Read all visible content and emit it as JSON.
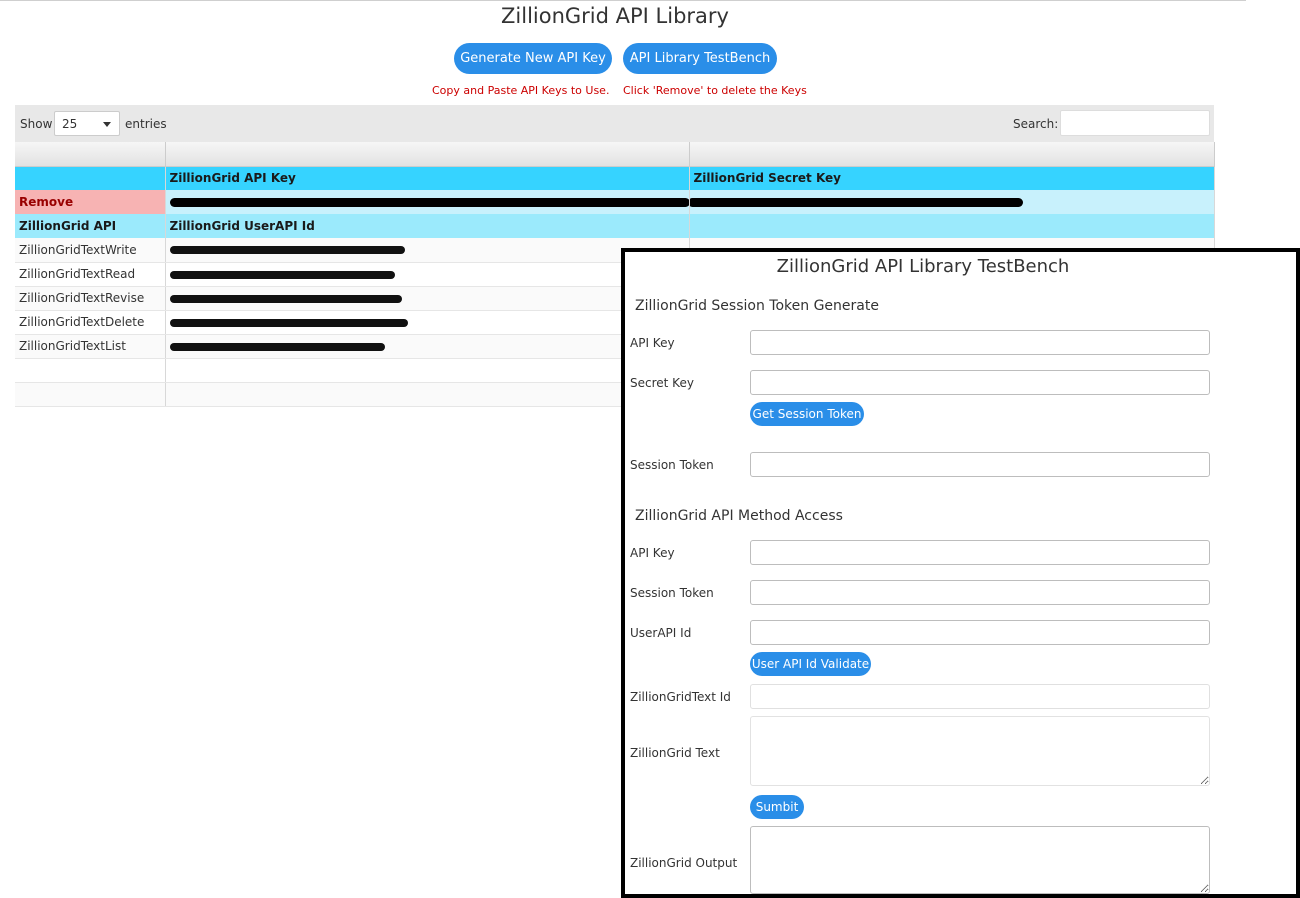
{
  "header": {
    "title": "ZillionGrid API Library",
    "generate_button": "Generate New API Key",
    "testbench_button": "API Library TestBench",
    "notice_copy": "Copy and Paste API Keys to Use.",
    "notice_remove": "Click 'Remove' to delete the Keys"
  },
  "table_controls": {
    "show_label": "Show",
    "entries_value": "25",
    "entries_label": "entries",
    "search_label": "Search:",
    "search_value": ""
  },
  "table": {
    "key_headers": [
      "",
      "ZillionGrid API Key",
      "ZillionGrid Secret Key"
    ],
    "remove_label": "Remove",
    "api_headers": [
      "ZillionGrid API",
      "ZillionGrid UserAPI Id",
      ""
    ],
    "rows": [
      {
        "api": "ZillionGridTextWrite"
      },
      {
        "api": "ZillionGridTextRead"
      },
      {
        "api": "ZillionGridTextRevise"
      },
      {
        "api": "ZillionGridTextDelete"
      },
      {
        "api": "ZillionGridTextList"
      }
    ]
  },
  "testbench": {
    "title": "ZillionGrid API Library TestBench",
    "section_token": "ZillionGrid Session Token Generate",
    "api_key_label": "API Key",
    "secret_key_label": "Secret Key",
    "get_token_button": "Get Session Token",
    "session_token_label": "Session Token",
    "section_method": "ZillionGrid API Method Access",
    "method_api_key_label": "API Key",
    "method_session_token_label": "Session Token",
    "userapi_id_label": "UserAPI Id",
    "validate_button": "User API Id Validate",
    "text_id_label": "ZillionGridText Id",
    "text_label": "ZillionGrid Text",
    "submit_button": "Sumbit",
    "output_label": "ZillionGrid Output"
  },
  "colors": {
    "primary_button": "#2a8ee8",
    "header_cyan": "#36d3ff",
    "remove_red": "#f7b3b3",
    "notice_red": "#cc0000"
  }
}
